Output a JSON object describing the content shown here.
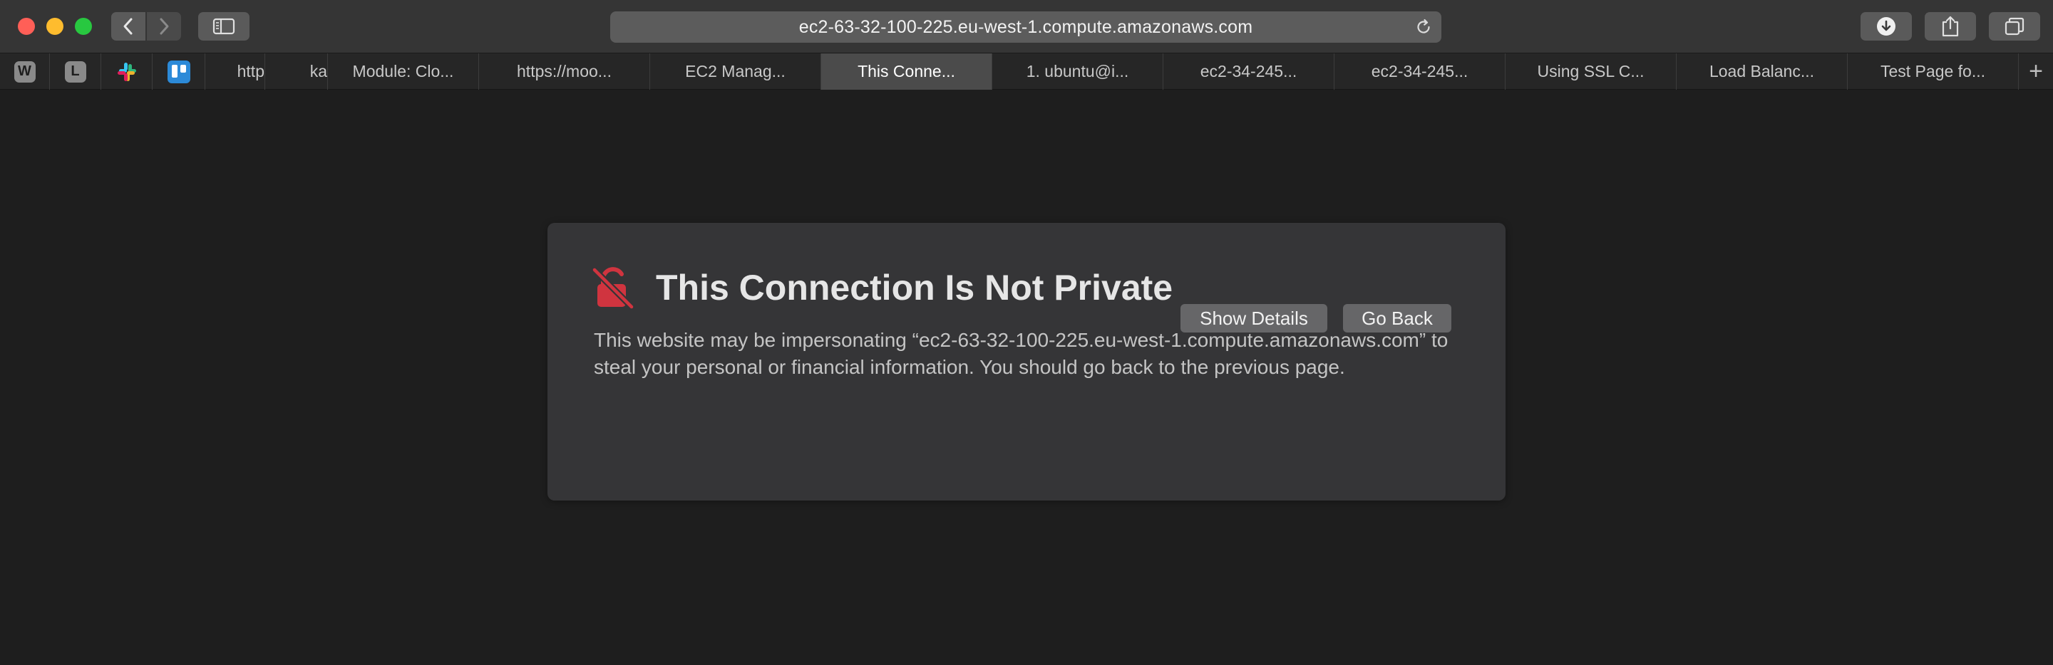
{
  "browser": {
    "address": "ec2-63-32-100-225.eu-west-1.compute.amazonaws.com",
    "icons": {
      "back": "chevron-left-icon",
      "forward": "chevron-right-icon",
      "sidebar": "sidebar-icon",
      "reload": "reload-icon",
      "download": "download-icon",
      "share": "share-icon",
      "tabs": "tab-overview-icon",
      "new_tab": "plus-icon"
    }
  },
  "pinned_tabs": [
    {
      "label": "W",
      "icon": "wordpress-favicon"
    },
    {
      "label": "L",
      "icon": "letter-favicon"
    },
    {
      "label": "",
      "icon": "slack-favicon"
    },
    {
      "label": "",
      "icon": "trello-favicon"
    }
  ],
  "tabs": [
    {
      "label": "http"
    },
    {
      "label": "ka"
    },
    {
      "label": "Module: Clo..."
    },
    {
      "label": "https://moo..."
    },
    {
      "label": "EC2 Manag..."
    },
    {
      "label": "This Conne...",
      "active": true
    },
    {
      "label": "1. ubuntu@i..."
    },
    {
      "label": "ec2-34-245..."
    },
    {
      "label": "ec2-34-245..."
    },
    {
      "label": "Using SSL C..."
    },
    {
      "label": "Load Balanc..."
    },
    {
      "label": "Test Page fo..."
    }
  ],
  "new_tab_label": "+",
  "dialog": {
    "title": "This Connection Is Not Private",
    "body": "This website may be impersonating “ec2-63-32-100-225.eu-west-1.compute.amazonaws.com” to steal your personal or financial information. You should go back to the previous page.",
    "show_details_label": "Show Details",
    "go_back_label": "Go Back",
    "icon": "broken-lock-icon"
  },
  "colors": {
    "warning_red": "#d0343f",
    "window_bg": "#1e1e1e",
    "dialog_bg": "#353537"
  }
}
